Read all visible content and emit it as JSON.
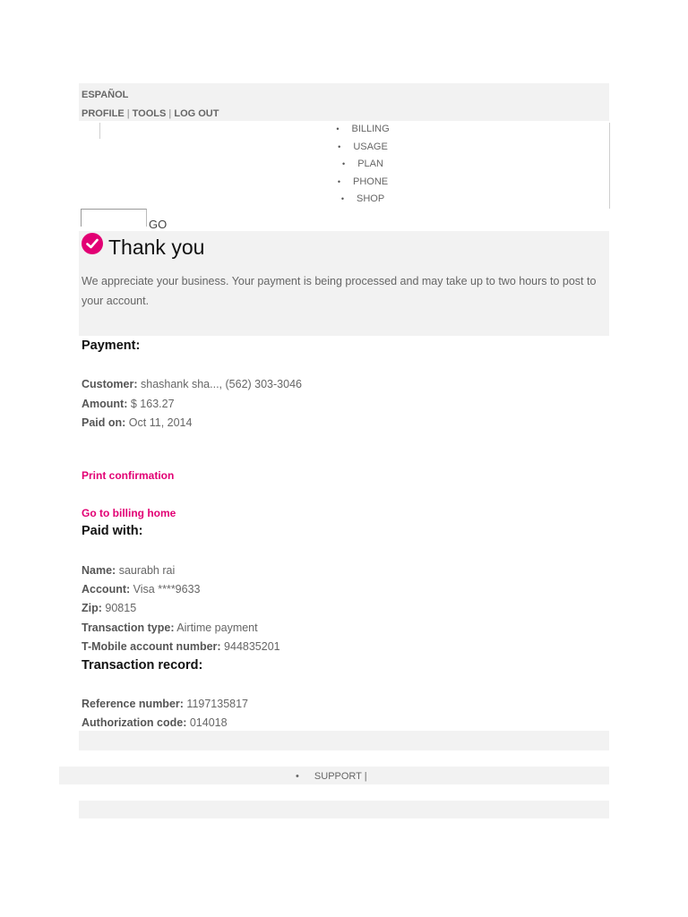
{
  "header": {
    "language_link": "ESPAÑOL",
    "profile_link": "PROFILE",
    "tools_link": "TOOLS",
    "logout_link": "LOG OUT",
    "separator": "|"
  },
  "nav": {
    "bullet": "•",
    "items": [
      {
        "label": "BILLING"
      },
      {
        "label": "USAGE"
      },
      {
        "label": "PLAN"
      },
      {
        "label": "PHONE"
      },
      {
        "label": "SHOP"
      }
    ]
  },
  "search": {
    "value": "",
    "go_label": "GO"
  },
  "thanks": {
    "icon": "check-circle-icon",
    "title": "Thank you",
    "message": "We appreciate your business. Your payment is being processed and may take up to two hours to post to your account."
  },
  "payment": {
    "heading": "Payment:",
    "customer_label": "Customer:",
    "customer_value": "shashank sha..., (562) 303-3046",
    "amount_label": "Amount:",
    "amount_value": "$ 163.27",
    "paid_on_label": "Paid on:",
    "paid_on_value": "Oct 11, 2014"
  },
  "links": {
    "print": "Print confirmation",
    "billing_home": "Go to billing home"
  },
  "paid_with": {
    "heading": "Paid with:",
    "name_label": "Name:",
    "name_value": "saurabh rai",
    "account_label": "Account:",
    "account_value": "Visa ****9633",
    "zip_label": "Zip:",
    "zip_value": "90815",
    "transaction_type_label": "Transaction type:",
    "transaction_type_value": "Airtime payment",
    "tmobile_account_label": "T-Mobile account number:",
    "tmobile_account_value": "944835201"
  },
  "transaction_record": {
    "heading": "Transaction record:",
    "reference_label": "Reference number:",
    "reference_value": "1197135817",
    "authorization_label": "Authorization code:",
    "authorization_value": "014018"
  },
  "footer": {
    "bullet": "•",
    "support_link": "SUPPORT",
    "separator": "|"
  },
  "colors": {
    "accent": "#e20074",
    "panel": "#f2f2f2",
    "text": "#666666"
  }
}
